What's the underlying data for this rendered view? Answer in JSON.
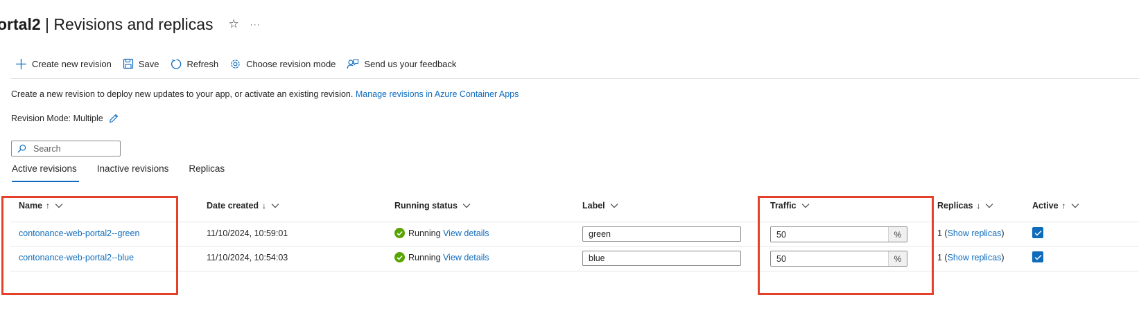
{
  "header": {
    "title_prefix": "ortal2",
    "title_separator": " | ",
    "title_main": "Revisions and replicas",
    "star_icon": "☆",
    "more_icon": "···"
  },
  "toolbar": {
    "create_label": "Create new revision",
    "save_label": "Save",
    "refresh_label": "Refresh",
    "mode_label": "Choose revision mode",
    "feedback_label": "Send us your feedback"
  },
  "description": {
    "text": "Create a new revision to deploy new updates to your app, or activate an existing revision.",
    "link": "Manage revisions in Azure Container Apps"
  },
  "revision_mode": {
    "label": "Revision Mode: Multiple"
  },
  "search": {
    "placeholder": "Search"
  },
  "tabs": [
    {
      "label": "Active revisions",
      "active": true
    },
    {
      "label": "Inactive revisions",
      "active": false
    },
    {
      "label": "Replicas",
      "active": false
    }
  ],
  "table": {
    "columns": {
      "name": {
        "label": "Name",
        "sort": "↑"
      },
      "date": {
        "label": "Date created",
        "sort": "↓"
      },
      "status": {
        "label": "Running status"
      },
      "label": {
        "label": "Label"
      },
      "traffic": {
        "label": "Traffic"
      },
      "replicas": {
        "label": "Replicas",
        "sort": "↓"
      },
      "active": {
        "label": "Active",
        "sort": "↑"
      }
    },
    "rows": [
      {
        "name": "contonance-web-portal2--green",
        "date": "11/10/2024, 10:59:01",
        "status": "Running",
        "details_link": "View details",
        "label": "green",
        "traffic": "50",
        "traffic_unit": "%",
        "replica_count": "1 (",
        "replica_link": "Show replicas",
        "replica_close": ")",
        "active": true
      },
      {
        "name": "contonance-web-portal2--blue",
        "date": "11/10/2024, 10:54:03",
        "status": "Running",
        "details_link": "View details",
        "label": "blue",
        "traffic": "50",
        "traffic_unit": "%",
        "replica_count": "1 (",
        "replica_link": "Show replicas",
        "replica_close": ")",
        "active": true
      }
    ]
  },
  "colors": {
    "accent": "#0f6cbd",
    "running": "#57a300",
    "highlight": "#e5412a"
  }
}
